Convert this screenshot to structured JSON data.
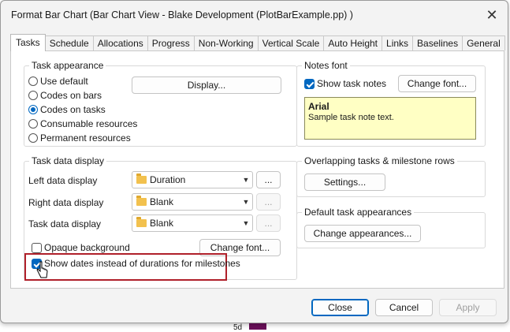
{
  "window": {
    "title": "Format Bar Chart (Bar Chart View - Blake Development (PlotBarExample.pp) )"
  },
  "tabs": [
    {
      "label": "Tasks",
      "active": true
    },
    {
      "label": "Schedule"
    },
    {
      "label": "Allocations"
    },
    {
      "label": "Progress"
    },
    {
      "label": "Non-Working"
    },
    {
      "label": "Vertical Scale"
    },
    {
      "label": "Auto Height"
    },
    {
      "label": "Links"
    },
    {
      "label": "Baselines"
    },
    {
      "label": "General"
    }
  ],
  "task_appearance": {
    "title": "Task appearance",
    "options": [
      {
        "label": "Use default",
        "selected": false
      },
      {
        "label": "Codes on bars",
        "selected": false
      },
      {
        "label": "Codes on tasks",
        "selected": true
      },
      {
        "label": "Consumable resources",
        "selected": false
      },
      {
        "label": "Permanent resources",
        "selected": false
      }
    ],
    "display_button": "Display..."
  },
  "notes_font": {
    "title": "Notes font",
    "show_task_notes_label": "Show task notes",
    "show_task_notes_checked": true,
    "change_font_button": "Change font...",
    "sample_font_name": "Arial",
    "sample_text": "Sample task note text."
  },
  "task_data_display": {
    "title": "Task data display",
    "rows": [
      {
        "label": "Left data display",
        "value": "Duration",
        "more": "...",
        "more_enabled": true
      },
      {
        "label": "Right data display",
        "value": "Blank",
        "more": "...",
        "more_enabled": false
      },
      {
        "label": "Task data display",
        "value": "Blank",
        "more": "...",
        "more_enabled": false
      }
    ],
    "opaque_background_label": "Opaque background",
    "opaque_background_checked": false,
    "change_font_button": "Change font...",
    "show_dates_label": "Show dates instead of durations for milestones",
    "show_dates_checked": true
  },
  "overlapping": {
    "title": "Overlapping tasks & milestone rows",
    "settings_button": "Settings..."
  },
  "default_appearances": {
    "title": "Default task appearances",
    "change_button": "Change appearances..."
  },
  "footer": {
    "close": "Close",
    "cancel": "Cancel",
    "apply": "Apply"
  },
  "background": {
    "bar_label": "5d"
  },
  "colors": {
    "accent": "#0067c0",
    "highlight_box": "#b0202a",
    "note_bg": "#ffffc4"
  }
}
